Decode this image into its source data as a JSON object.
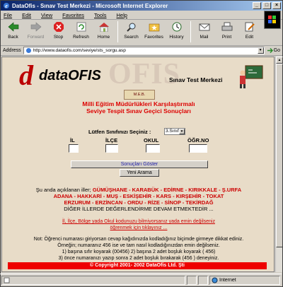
{
  "window": {
    "title": "DataOfis - Sınav Test Merkezi - Microsoft Internet Explorer"
  },
  "menu": [
    "File",
    "Edit",
    "View",
    "Favorites",
    "Tools",
    "Help"
  ],
  "toolbar": {
    "back": "Back",
    "forward": "Forward",
    "stop": "Stop",
    "refresh": "Refresh",
    "home": "Home",
    "search": "Search",
    "favorites": "Favorites",
    "history": "History",
    "mail": "Mail",
    "print": "Print",
    "edit": "Edit"
  },
  "address": {
    "label": "Address",
    "url": "http://www.dataofis.com/seviye/sts_sorgu.asp",
    "go": "Go"
  },
  "page": {
    "logo_d": "d",
    "logo_data": "dataOFIS",
    "logo_ofis_bg": "OFIS",
    "logo_subtitle": "Sınav Test Merkezi",
    "meb_badge": "M.E.B.",
    "heading1": "Milli Eğitim Müdürlükleri Karşılaştırmalı",
    "heading2": "Seviye Tespit Sınav Geçici Sonuçları",
    "class_label": "Lütfen Sınıfınızı Seçiniz :",
    "class_value": "3.Sınıf",
    "field_labels": {
      "il": "İL",
      "ilce": "İLÇE",
      "okul": "OKUL",
      "ogr": "ÖĞR.NO"
    },
    "show_results": "Sonuçları Göster",
    "new_search": "Yeni Arama",
    "cities_intro": "Şu anda açıklanan iller;",
    "cities_line1": "GÜMÜŞHANE - KARABÜK - EDİRNE - KIRIKKALE - Ş.URFA",
    "cities_line2": "ADANA - HAKKARİ - MUŞ - ESKİŞEHİR - KARS - KIRŞEHİR - TOKAT",
    "cities_line3": "ERZURUM - ERZİNCAN - ORDU - RİZE - SİNOP - TEKİRDAĞ",
    "cities_line4": "DİĞER İLLERDE DEĞERLENDİRME DEVAM ETMEKTEDİR ...",
    "link_line1": "İl, İlçe, Bölge yada Okul kodunuzu bilmiyorsanız yada emin değilseniz",
    "link_line2": "öğrenmek için tıklayınız ...",
    "note1": "Not: Öğrenci numarası giriyorsan cevap kağıdınızda kodladığınız biçimde girmeye dikkat ediniz.",
    "note2": "Örneğin; numaranız 456 ise ve tam nasıl kodladığınızdan emin değilseniz.",
    "note3": "1) başına sıfır koyarak (00456)  2) başına 2 adet boşluk koyarak (   456)",
    "note4": "3) önce numaranızı yazıp sonra  2 adet boşluk bırakarak (456   ) deneyiniz.",
    "footer": "© Copyright 2001- 2002 DataOfis Ltd. Şti"
  },
  "status": {
    "text": "",
    "zone": "Internet"
  }
}
